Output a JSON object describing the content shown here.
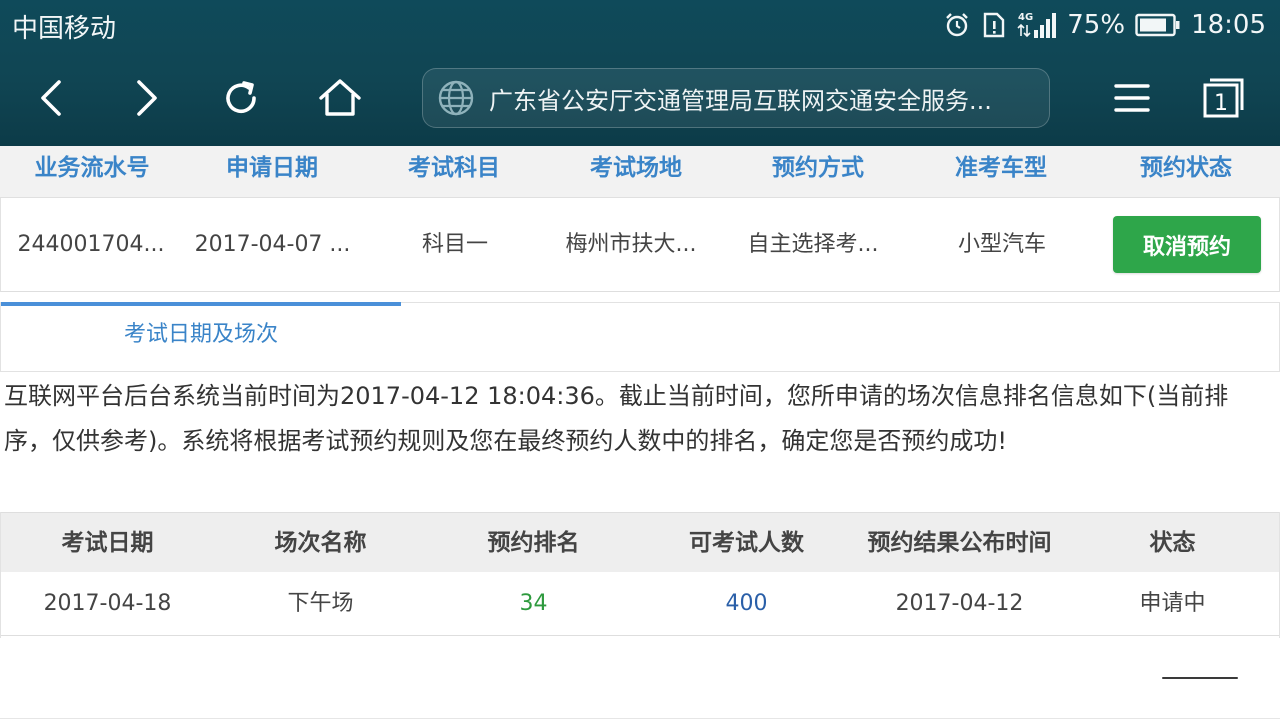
{
  "status_bar": {
    "carrier": "中国移动",
    "network": "4G",
    "battery": "75%",
    "time": "18:05"
  },
  "browser": {
    "url_title": "广东省公安厅交通管理局互联网交通安全服务...",
    "tab_count": "1"
  },
  "reservation_table": {
    "headers": [
      "业务流水号",
      "申请日期",
      "考试科目",
      "考试场地",
      "预约方式",
      "准考车型",
      "预约状态"
    ],
    "row": {
      "serial": "244001704...",
      "apply_date": "2017-04-07 ...",
      "subject": "科目一",
      "venue": "梅州市扶大...",
      "method": "自主选择考...",
      "vehicle": "小型汽车"
    },
    "cancel_label": "取消预约"
  },
  "tab": {
    "label": "考试日期及场次"
  },
  "notice": "互联网平台后台系统当前时间为2017-04-12 18:04:36。截止当前时间，您所申请的场次信息排名信息如下(当前排序，仅供参考)。系统将根据考试预约规则及您在最终预约人数中的排名，确定您是否预约成功!",
  "session_table": {
    "headers": [
      "考试日期",
      "场次名称",
      "预约排名",
      "可考试人数",
      "预约结果公布时间",
      "状态"
    ],
    "row": {
      "exam_date": "2017-04-18",
      "session": "下午场",
      "rank": "34",
      "capacity": "400",
      "publish_date": "2017-04-12",
      "status": "申请中"
    }
  },
  "colors": {
    "header_bg": "#104553",
    "accent_blue": "#3a84c8",
    "button_green": "#2ea64a",
    "rank_green": "#2e9a3e",
    "count_blue": "#2a5fa8"
  }
}
